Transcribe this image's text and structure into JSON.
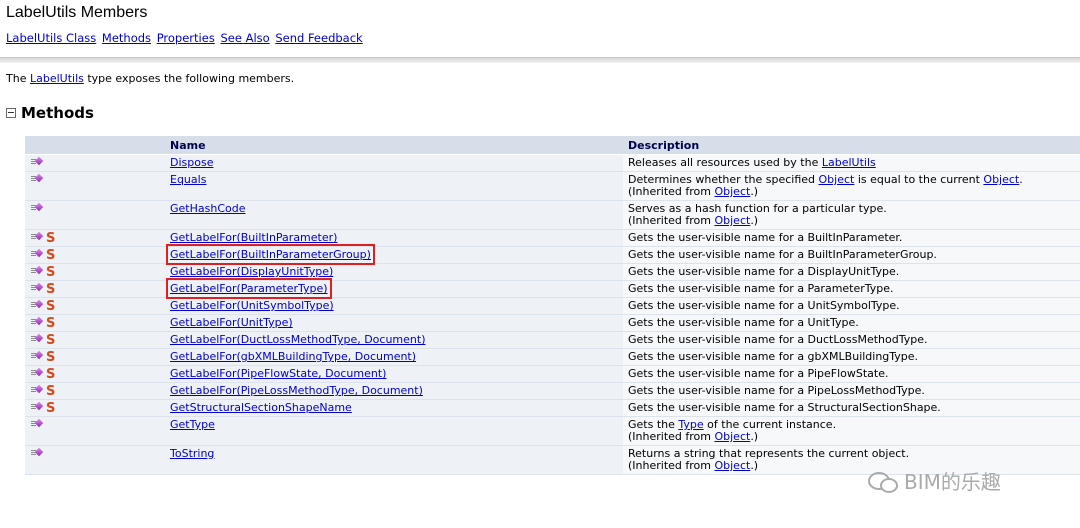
{
  "page": {
    "title": "LabelUtils Members",
    "nav_links": [
      "LabelUtils Class",
      "Methods",
      "Properties",
      "See Also",
      "Send Feedback"
    ],
    "intro": {
      "prefix": "The ",
      "link": "LabelUtils",
      "suffix": " type exposes the following members."
    },
    "section_title": "Methods"
  },
  "table": {
    "headers": {
      "icon": "",
      "name": "Name",
      "description": "Description"
    },
    "rows": [
      {
        "name": "Dispose",
        "static": false,
        "highlighted": false,
        "desc": {
          "a": "Releases all resources used by the ",
          "link1": "LabelUtils",
          "b": "",
          "link2": "",
          "c": "",
          "inh_link": "",
          "inh_end": ""
        }
      },
      {
        "name": "Equals",
        "static": false,
        "highlighted": false,
        "desc": {
          "a": "Determines whether the specified ",
          "link1": "Object",
          "b": " is equal to the current ",
          "link2": "Object",
          "c": ".",
          "inh_link": "Object",
          "inh_end": ".)"
        }
      },
      {
        "name": "GetHashCode",
        "static": false,
        "highlighted": false,
        "desc": {
          "a": "Serves as a hash function for a particular type.",
          "link1": "",
          "b": "",
          "link2": "",
          "c": "",
          "inh_link": "Object",
          "inh_end": ".)"
        }
      },
      {
        "name": "GetLabelFor(BuiltInParameter)",
        "static": true,
        "highlighted": false,
        "desc": {
          "a": "Gets the user-visible name for a BuiltInParameter.",
          "link1": "",
          "b": "",
          "link2": "",
          "c": "",
          "inh_link": "",
          "inh_end": ""
        }
      },
      {
        "name": "GetLabelFor(BuiltInParameterGroup)",
        "static": true,
        "highlighted": true,
        "desc": {
          "a": "Gets the user-visible name for a BuiltInParameterGroup.",
          "link1": "",
          "b": "",
          "link2": "",
          "c": "",
          "inh_link": "",
          "inh_end": ""
        }
      },
      {
        "name": "GetLabelFor(DisplayUnitType)",
        "static": true,
        "highlighted": false,
        "desc": {
          "a": "Gets the user-visible name for a DisplayUnitType.",
          "link1": "",
          "b": "",
          "link2": "",
          "c": "",
          "inh_link": "",
          "inh_end": ""
        }
      },
      {
        "name": "GetLabelFor(ParameterType)",
        "static": true,
        "highlighted": true,
        "desc": {
          "a": "Gets the user-visible name for a ParameterType.",
          "link1": "",
          "b": "",
          "link2": "",
          "c": "",
          "inh_link": "",
          "inh_end": ""
        }
      },
      {
        "name": "GetLabelFor(UnitSymbolType)",
        "static": true,
        "highlighted": false,
        "desc": {
          "a": "Gets the user-visible name for a UnitSymbolType.",
          "link1": "",
          "b": "",
          "link2": "",
          "c": "",
          "inh_link": "",
          "inh_end": ""
        }
      },
      {
        "name": "GetLabelFor(UnitType)",
        "static": true,
        "highlighted": false,
        "desc": {
          "a": "Gets the user-visible name for a UnitType.",
          "link1": "",
          "b": "",
          "link2": "",
          "c": "",
          "inh_link": "",
          "inh_end": ""
        }
      },
      {
        "name": "GetLabelFor(DuctLossMethodType, Document)",
        "static": true,
        "highlighted": false,
        "desc": {
          "a": "Gets the user-visible name for a DuctLossMethodType.",
          "link1": "",
          "b": "",
          "link2": "",
          "c": "",
          "inh_link": "",
          "inh_end": ""
        }
      },
      {
        "name": "GetLabelFor(gbXMLBuildingType, Document)",
        "static": true,
        "highlighted": false,
        "desc": {
          "a": "Gets the user-visible name for a gbXMLBuildingType.",
          "link1": "",
          "b": "",
          "link2": "",
          "c": "",
          "inh_link": "",
          "inh_end": ""
        }
      },
      {
        "name": "GetLabelFor(PipeFlowState, Document)",
        "static": true,
        "highlighted": false,
        "desc": {
          "a": "Gets the user-visible name for a PipeFlowState.",
          "link1": "",
          "b": "",
          "link2": "",
          "c": "",
          "inh_link": "",
          "inh_end": ""
        }
      },
      {
        "name": "GetLabelFor(PipeLossMethodType, Document)",
        "static": true,
        "highlighted": false,
        "desc": {
          "a": "Gets the user-visible name for a PipeLossMethodType.",
          "link1": "",
          "b": "",
          "link2": "",
          "c": "",
          "inh_link": "",
          "inh_end": ""
        }
      },
      {
        "name": "GetStructuralSectionShapeName",
        "static": true,
        "highlighted": false,
        "desc": {
          "a": "Gets the user-visible name for a StructuralSectionShape.",
          "link1": "",
          "b": "",
          "link2": "",
          "c": "",
          "inh_link": "",
          "inh_end": ""
        }
      },
      {
        "name": "GetType",
        "static": false,
        "highlighted": false,
        "desc": {
          "a": "Gets the ",
          "link1": "Type",
          "b": " of the current instance.",
          "link2": "",
          "c": "",
          "inh_link": "Object",
          "inh_end": ".)"
        }
      },
      {
        "name": "ToString",
        "static": false,
        "highlighted": false,
        "desc": {
          "a": "Returns a string that represents the current object.",
          "link1": "",
          "b": "",
          "link2": "",
          "c": "",
          "inh_link": "Object",
          "inh_end": ".)"
        }
      }
    ],
    "inherited_prefix": "(Inherited from ",
    "static_icon_glyph": "S",
    "highlight_color": "#e02020"
  },
  "watermark": {
    "text": "BIM的乐趣",
    "icon": "wechat-icon"
  }
}
